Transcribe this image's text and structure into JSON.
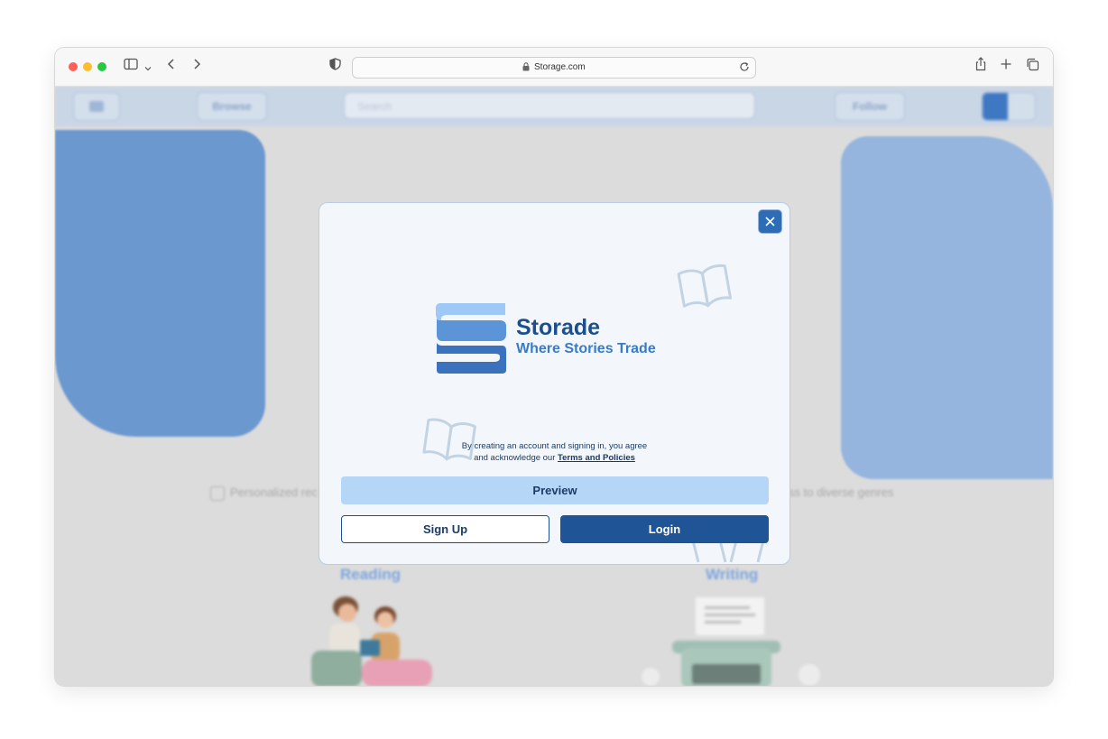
{
  "browser": {
    "url": "Storage.com"
  },
  "background": {
    "nav": {
      "browse_label": "Browse",
      "search_placeholder": "Search",
      "follow_label": "Follow"
    },
    "feature_left": "Personalized rec",
    "feature_right": "ss to diverse genres",
    "reading_heading": "Reading",
    "writing_heading": "Writing"
  },
  "modal": {
    "brand_name": "Storade",
    "tagline": "Where Stories Trade",
    "agreement_line1": "By creating an account and signing in, you agree",
    "agreement_line2_prefix": "and acknowledge our ",
    "terms_link": "Terms and Policies",
    "preview_label": "Preview",
    "signup_label": "Sign Up",
    "login_label": "Login",
    "icons": {
      "close": "close-icon",
      "decor": "open-book-icon"
    }
  },
  "colors": {
    "brand_dark": "#1d4f8e",
    "brand_mid": "#3a7bc7",
    "brand_light": "#b6d6f8",
    "login_bg": "#1f5597"
  }
}
